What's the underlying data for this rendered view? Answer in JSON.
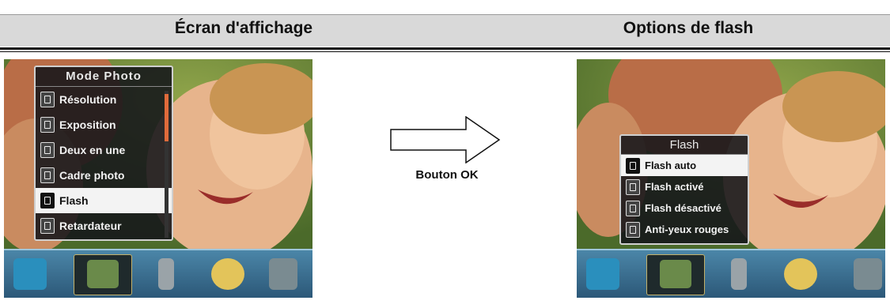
{
  "header": {
    "left_title": "Écran d'affichage",
    "right_title": "Options de flash"
  },
  "left_menu": {
    "title": "Mode Photo",
    "items": [
      {
        "label": "Résolution",
        "icon": "resolution-icon",
        "selected": false
      },
      {
        "label": "Exposition",
        "icon": "exposure-icon",
        "selected": false
      },
      {
        "label": "Deux en une",
        "icon": "two-in-one-icon",
        "selected": false
      },
      {
        "label": "Cadre photo",
        "icon": "photo-frame-icon",
        "selected": false
      },
      {
        "label": "Flash",
        "icon": "flash-icon",
        "selected": true
      },
      {
        "label": "Retardateur",
        "icon": "self-timer-icon",
        "selected": false
      }
    ]
  },
  "right_menu": {
    "title": "Flash",
    "items": [
      {
        "label": "Flash auto",
        "icon": "flash-auto-icon",
        "selected": true
      },
      {
        "label": "Flash activé",
        "icon": "flash-on-icon",
        "selected": false
      },
      {
        "label": "Flash désactivé",
        "icon": "flash-off-icon",
        "selected": false
      },
      {
        "label": "Anti-yeux rouges",
        "icon": "red-eye-icon",
        "selected": false
      }
    ]
  },
  "arrow": {
    "label": "Bouton OK"
  },
  "toolbar_icons": [
    "video-mode-icon",
    "camera-mode-icon",
    "microphone-icon",
    "palette-icon",
    "tools-icon"
  ],
  "colors": {
    "header_bg": "#d9d9d9",
    "menu_highlight": "#f3f3f3",
    "toolbar": "#3c6f92"
  }
}
